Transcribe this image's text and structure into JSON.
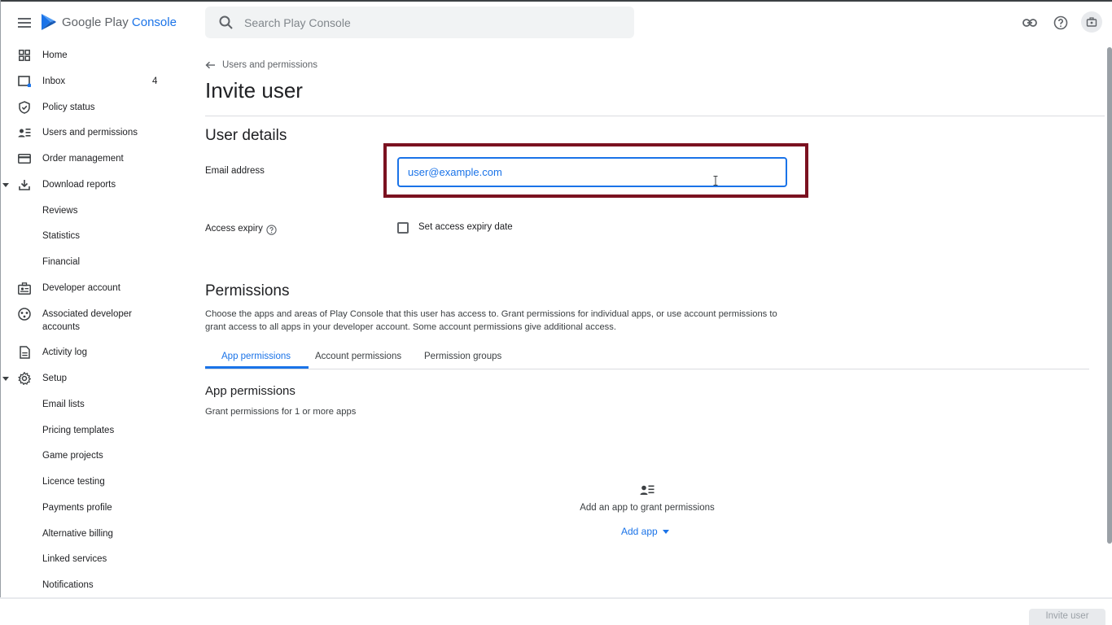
{
  "header": {
    "logo_prefix": "Google Play",
    "logo_accent": "Console",
    "search_placeholder": "Search Play Console"
  },
  "sidebar": {
    "items": [
      {
        "label": "Home",
        "icon": "grid-icon"
      },
      {
        "label": "Inbox",
        "icon": "inbox-icon",
        "badge": "4"
      },
      {
        "label": "Policy status",
        "icon": "shield-icon"
      },
      {
        "label": "Users and permissions",
        "icon": "users-icon"
      },
      {
        "label": "Order management",
        "icon": "card-icon"
      },
      {
        "label": "Download reports",
        "icon": "download-icon",
        "expanded": true
      },
      {
        "label": "Reviews"
      },
      {
        "label": "Statistics"
      },
      {
        "label": "Financial"
      },
      {
        "label": "Developer account",
        "icon": "badge-icon"
      },
      {
        "label": "Associated developer accounts",
        "icon": "associated-icon"
      },
      {
        "label": "Activity log",
        "icon": "document-icon"
      },
      {
        "label": "Setup",
        "icon": "gear-icon",
        "expanded": true
      },
      {
        "label": "Email lists"
      },
      {
        "label": "Pricing templates"
      },
      {
        "label": "Game projects"
      },
      {
        "label": "Licence testing"
      },
      {
        "label": "Payments profile"
      },
      {
        "label": "Alternative billing"
      },
      {
        "label": "Linked services"
      },
      {
        "label": "Notifications"
      }
    ]
  },
  "main": {
    "breadcrumb": "Users and permissions",
    "title": "Invite user",
    "user_details": {
      "heading": "User details",
      "email_label": "Email address",
      "email_placeholder": "user@example.com",
      "expiry_label": "Access expiry",
      "expiry_checkbox_label": "Set access expiry date",
      "expiry_checked": false
    },
    "permissions": {
      "heading": "Permissions",
      "description": "Choose the apps and areas of Play Console that this user has access to. Grant permissions for individual apps, or use account permissions to grant access to all apps in your developer account. Some account permissions give additional access.",
      "tabs": [
        "App permissions",
        "Account permissions",
        "Permission groups"
      ],
      "active_tab": "App permissions",
      "app_permissions_title": "App permissions",
      "app_permissions_desc": "Grant permissions for 1 or more apps",
      "empty_text": "Add an app to grant permissions",
      "add_app_label": "Add app"
    }
  },
  "footer": {
    "invite_button": "Invite user",
    "invite_enabled": false
  },
  "colors": {
    "accent": "#1a73e8",
    "highlight_box": "#7b1120"
  }
}
